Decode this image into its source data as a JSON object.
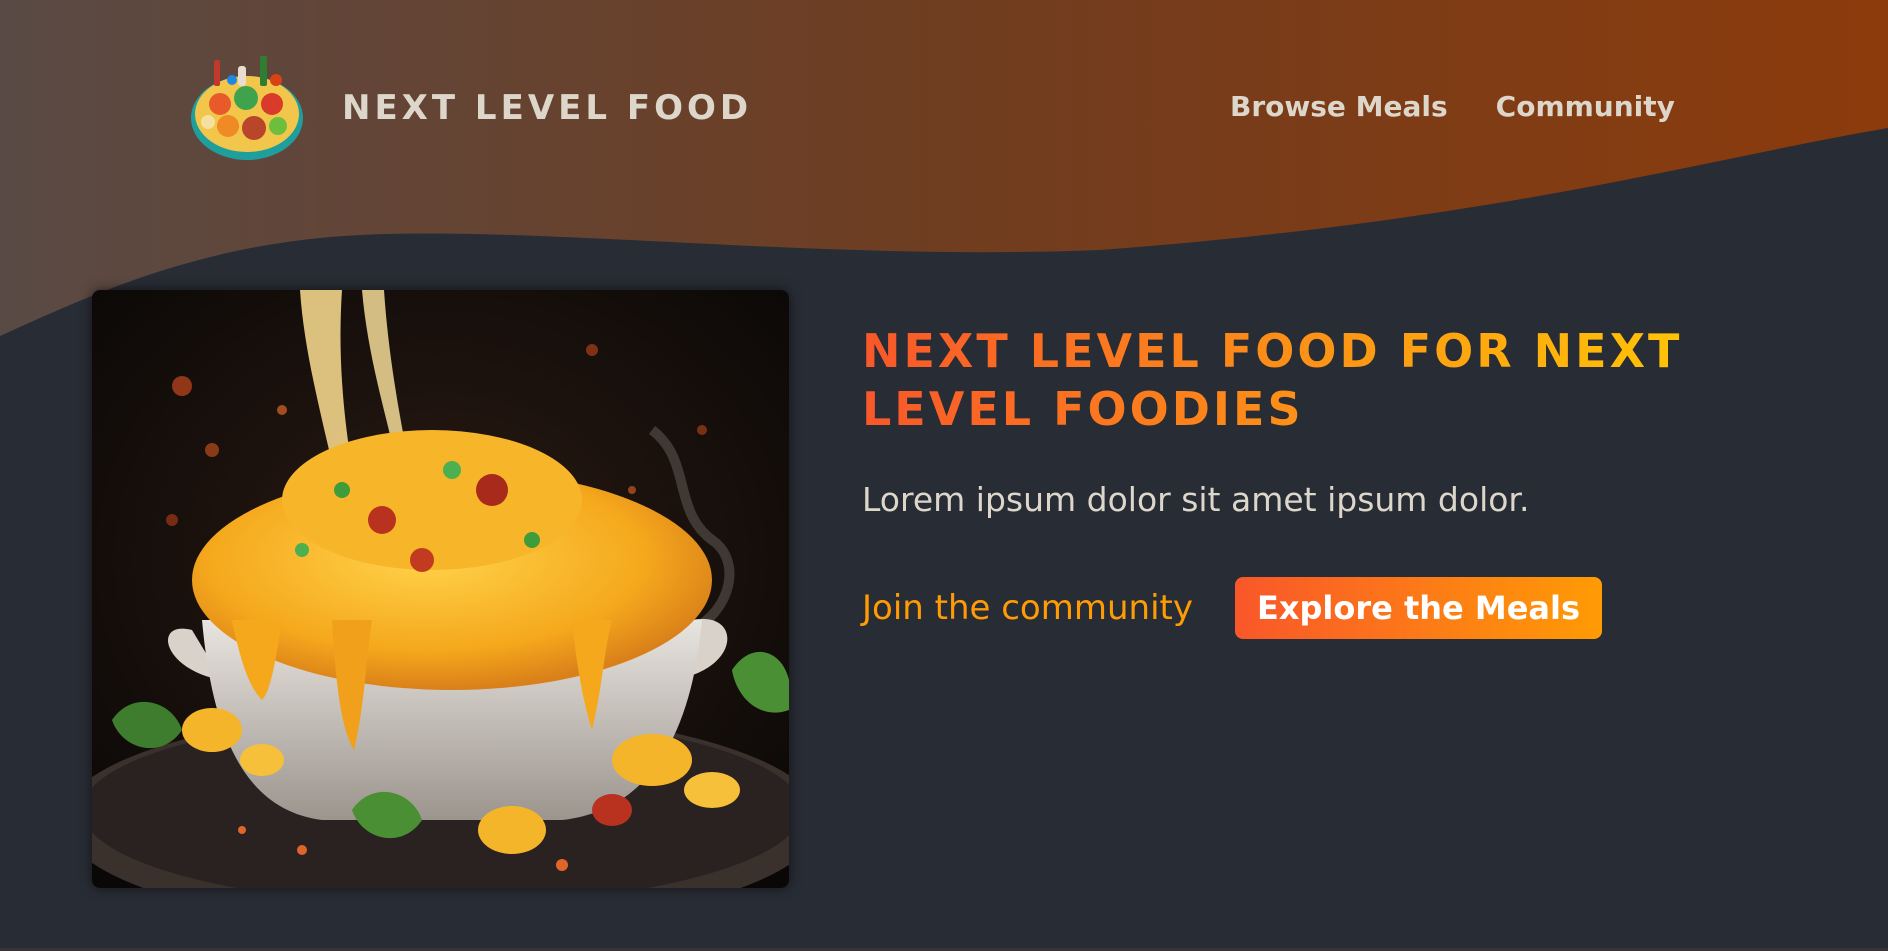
{
  "header": {
    "logo_text": "NEXT LEVEL FOOD",
    "logo_image": "logo-food-platter-icon",
    "nav": [
      {
        "label": "Browse Meals"
      },
      {
        "label": "Community"
      }
    ]
  },
  "hero": {
    "image": "mac-and-cheese-image",
    "title": "NEXT LEVEL FOOD FOR NEXT LEVEL FOODIES",
    "description": "Lorem ipsum dolor sit amet ipsum dolor.",
    "cta_link": "Join the community",
    "cta_button": "Explore the Meals"
  },
  "colors": {
    "background": "#282c34",
    "header_gradient_start": "#5a4a45",
    "header_gradient_end": "#8c3b0c",
    "accent_orange": "#f9572a",
    "accent_yellow": "#ffc905",
    "text_light": "#ddd6cb"
  }
}
